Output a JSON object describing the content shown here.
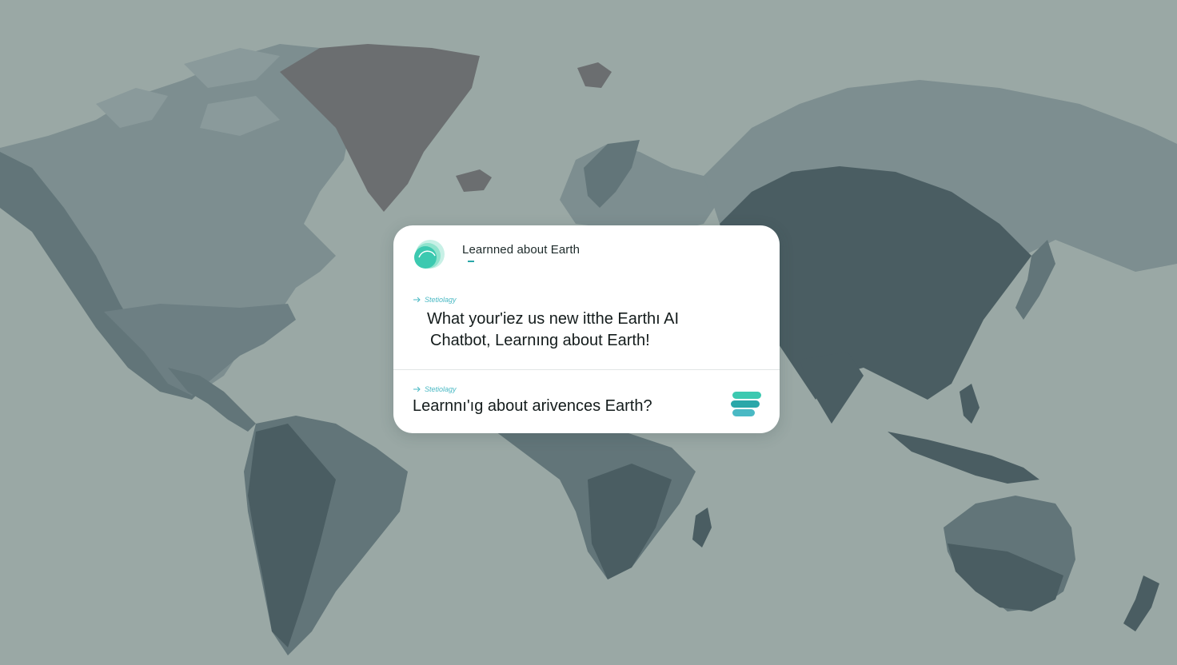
{
  "colors": {
    "background": "#9aa8a5",
    "land_light": "#7d8e90",
    "land_mid": "#627579",
    "land_dark": "#4a5d62",
    "greenland": "#6b6e70",
    "card": "#ffffff",
    "accent": "#3cc9b0",
    "tag": "#4ab9c4"
  },
  "card": {
    "logo_icon": "earth-chat-logo-icon",
    "title": "Learnned about Earth",
    "messages": [
      {
        "tag": "Stetiolagy",
        "lines": [
          "What your'iez us new itthe Earthı AI",
          "Chatbot, Learnıng about Earth!"
        ]
      }
    ],
    "input": {
      "tag": "Stetiolagy",
      "text": "Learnnı'ıg about arivences Earth?"
    },
    "send_icon": "stacked-send-icon"
  }
}
